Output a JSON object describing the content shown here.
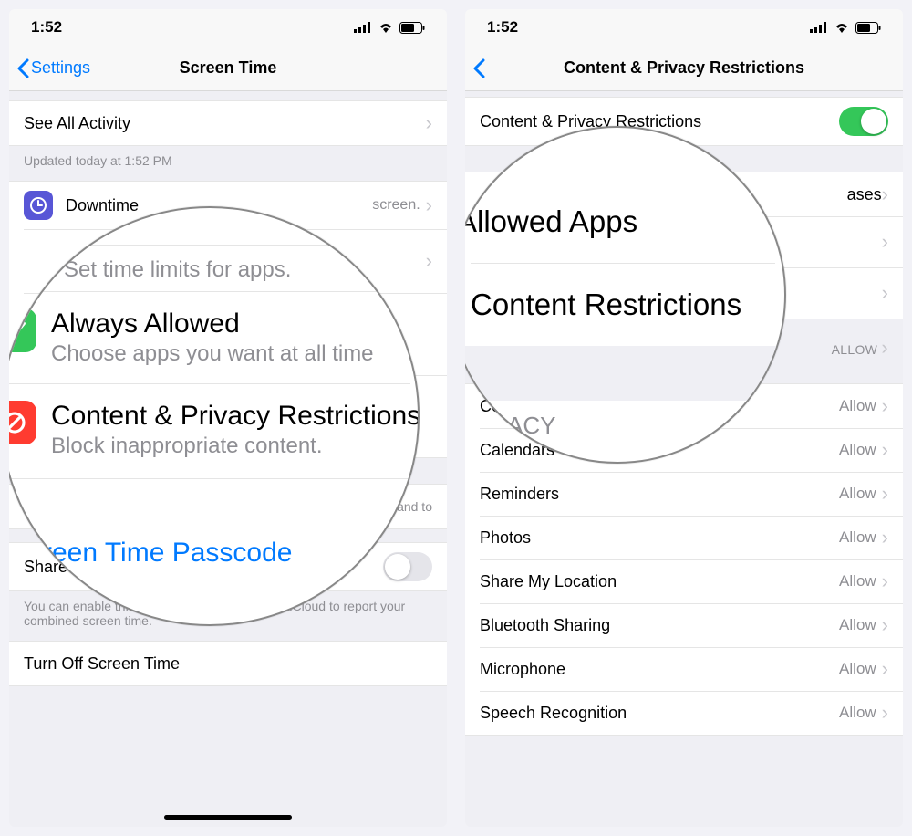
{
  "status": {
    "time": "1:52"
  },
  "left": {
    "back": "Settings",
    "title": "Screen Time",
    "see_all": "See All Activity",
    "updated": "Updated today at 1:52 PM",
    "downtime": {
      "title": "Downtime",
      "sub": "Set time limits for apps."
    },
    "always": {
      "title": "Always Allowed",
      "sub": "Choose apps you want at all time"
    },
    "content_priv": {
      "title": "Content & Privacy Restrictions",
      "sub": "Block inappropriate content."
    },
    "passcode": "Screen Time Passcode",
    "share_row": "Share Across Devices",
    "share_footer": "You can enable this on any device signed in to iCloud to report your combined screen time.",
    "turn_off": "Turn Off Screen Time",
    "away_hint": "screen."
  },
  "right": {
    "title": "Content & Privacy Restrictions",
    "toggle_label": "Content & Privacy Restrictions",
    "mag_allowed": "Allowed Apps",
    "mag_content": "Content Restrictions",
    "row_purchases_tail": "ases",
    "privacy_header": "PRIVACY",
    "detail_allow": "Allow",
    "items": [
      "Contacts",
      "Calendars",
      "Reminders",
      "Photos",
      "Share My Location",
      "Bluetooth Sharing",
      "Microphone",
      "Speech Recognition"
    ]
  }
}
